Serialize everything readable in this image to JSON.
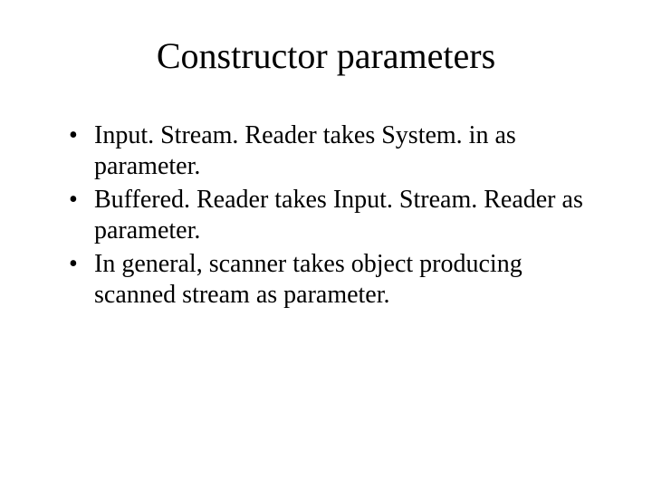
{
  "title": "Constructor parameters",
  "bullets": [
    "Input. Stream. Reader takes System. in as parameter.",
    "Buffered. Reader takes Input. Stream. Reader as parameter.",
    "In general, scanner takes object producing scanned stream as parameter."
  ]
}
